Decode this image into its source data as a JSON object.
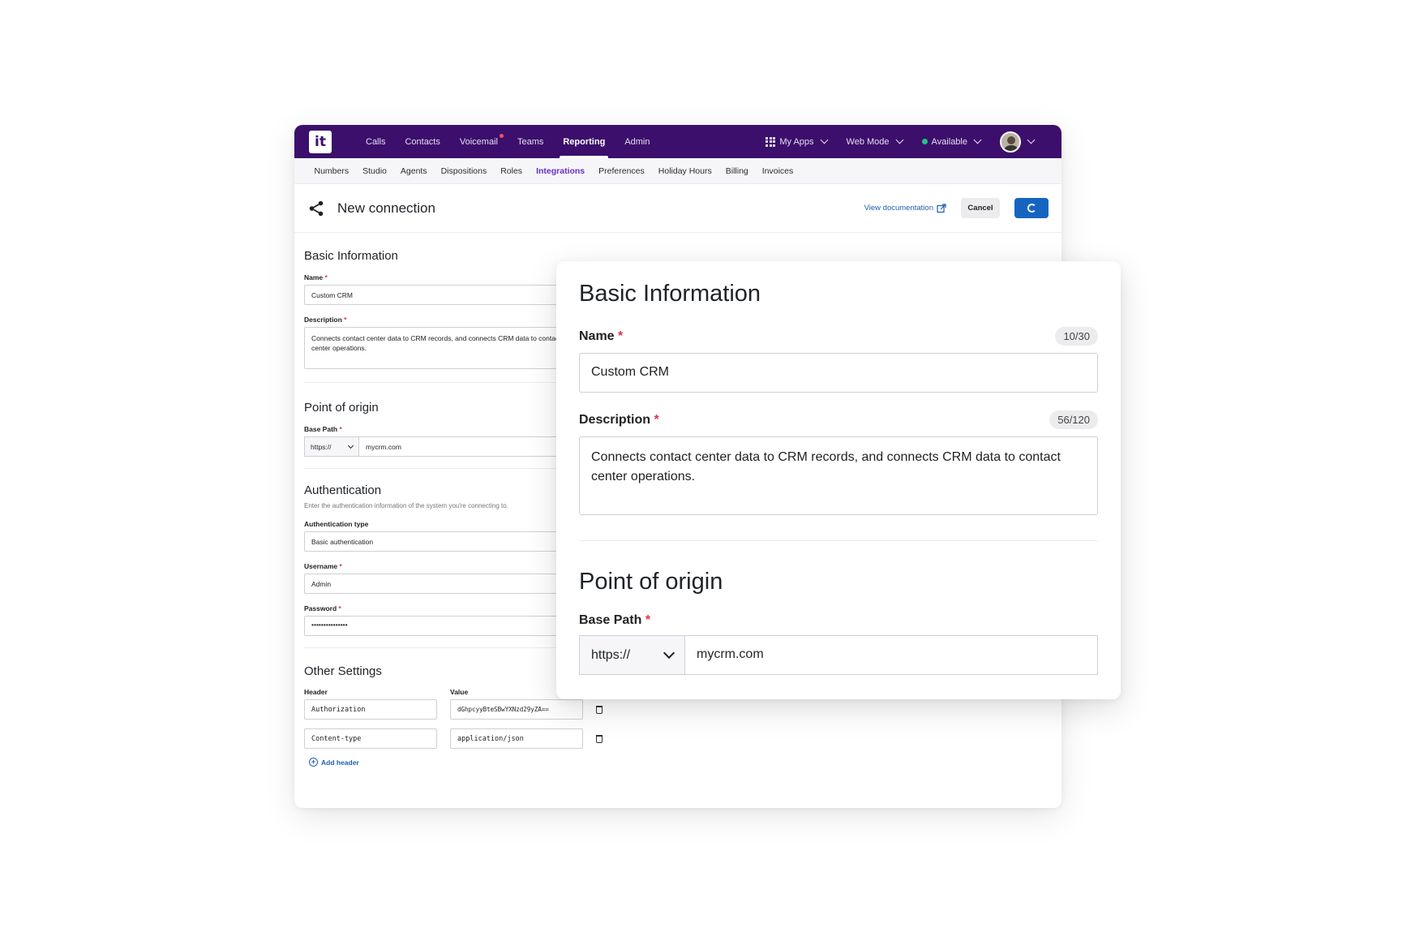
{
  "topnav": {
    "logo": "it",
    "items": [
      "Calls",
      "Contacts",
      "Voicemail",
      "Teams",
      "Reporting",
      "Admin"
    ],
    "my_apps": "My Apps",
    "web_mode": "Web Mode",
    "status": "Available"
  },
  "subnav": {
    "items": [
      "Numbers",
      "Studio",
      "Agents",
      "Dispositions",
      "Roles",
      "Integrations",
      "Preferences",
      "Holiday Hours",
      "Billing",
      "Invoices"
    ]
  },
  "header": {
    "title": "New connection",
    "doc_link": "View documentation",
    "cancel": "Cancel"
  },
  "form": {
    "basic_title": "Basic Information",
    "name_label": "Name",
    "name_value": "Custom CRM",
    "desc_label": "Description",
    "desc_value": "Connects contact center data to CRM records, and connects CRM data to contact center operations.",
    "origin_title": "Point of origin",
    "base_path_label": "Base Path",
    "protocol": "https://",
    "host": "mycrm.com",
    "auth_title": "Authentication",
    "auth_hint": "Enter the authentication information of the system you're connecting to.",
    "auth_type_label": "Authentication type",
    "auth_type_value": "Basic authentication",
    "username_label": "Username",
    "username_value": "Admin",
    "password_label": "Password",
    "password_value": "•••••••••••••••",
    "other_title": "Other Settings",
    "header_col": "Header",
    "value_col": "Value",
    "headers": [
      {
        "header": "Authorization",
        "value": "dGhpcyyBteSBwYXNzd29yZA=="
      },
      {
        "header": "Content-type",
        "value": "application/json"
      }
    ],
    "add_header": "Add header",
    "required_mark": "*"
  },
  "zoom": {
    "name_count": "10/30",
    "desc_count": "56/120"
  },
  "colors": {
    "brand": "#3b0f6b",
    "accent": "#6a2fc2",
    "primary_button": "#1565c0",
    "required": "#e0344e",
    "status_available": "#26c281"
  }
}
